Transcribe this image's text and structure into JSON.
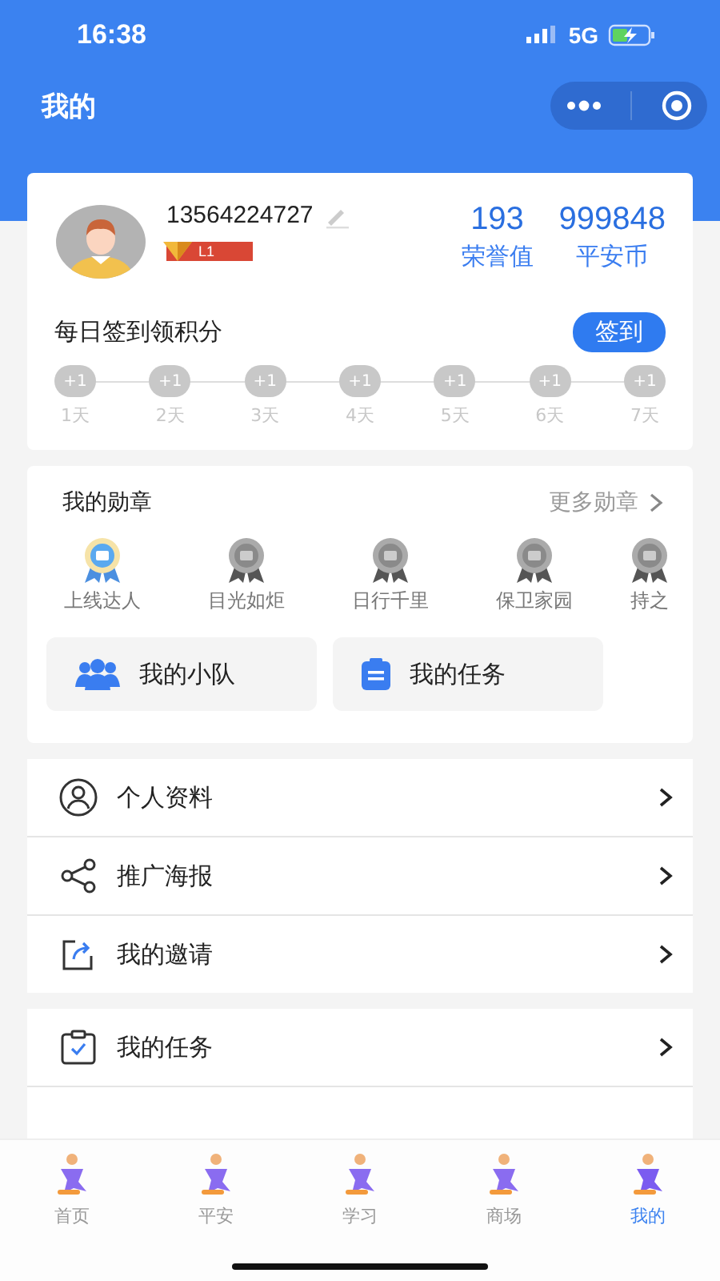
{
  "status_bar": {
    "time": "16:38",
    "network": "5G"
  },
  "nav": {
    "title": "我的"
  },
  "profile": {
    "phone": "13564224727",
    "level": "L1",
    "stats": [
      {
        "value": "193",
        "label": "荣誉值"
      },
      {
        "value": "999848",
        "label": "平安币"
      }
    ]
  },
  "checkin": {
    "title": "每日签到领积分",
    "button": "签到",
    "days": [
      {
        "points": "+1",
        "label": "1天",
        "signed": false
      },
      {
        "points": "+1",
        "label": "2天",
        "signed": false
      },
      {
        "points": "+1",
        "label": "3天",
        "signed": false
      },
      {
        "points": "+1",
        "label": "4天",
        "signed": false
      },
      {
        "points": "+1",
        "label": "5天",
        "signed": false
      },
      {
        "points": "+1",
        "label": "6天",
        "signed": false
      },
      {
        "points": "+1",
        "label": "7天",
        "signed": false
      }
    ]
  },
  "medals": {
    "title": "我的勋章",
    "more": "更多勋章",
    "items": [
      {
        "name": "上线达人",
        "earned": true
      },
      {
        "name": "目光如炬",
        "earned": false
      },
      {
        "name": "日行千里",
        "earned": false
      },
      {
        "name": "保卫家园",
        "earned": false
      },
      {
        "name": "持之",
        "earned": false
      }
    ]
  },
  "shortcuts": [
    {
      "kind": "team",
      "label": "我的小队"
    },
    {
      "kind": "task",
      "label": "我的任务"
    }
  ],
  "menu_groups": [
    [
      {
        "kind": "profile",
        "label": "个人资料"
      },
      {
        "kind": "share",
        "label": "推广海报"
      },
      {
        "kind": "invite",
        "label": "我的邀请"
      }
    ],
    [
      {
        "kind": "task",
        "label": "我的任务"
      }
    ]
  ],
  "tabs": [
    {
      "label": "首页",
      "selected": false
    },
    {
      "label": "平安",
      "selected": false
    },
    {
      "label": "学习",
      "selected": false
    },
    {
      "label": "商场",
      "selected": false
    },
    {
      "label": "我的",
      "selected": true
    }
  ]
}
